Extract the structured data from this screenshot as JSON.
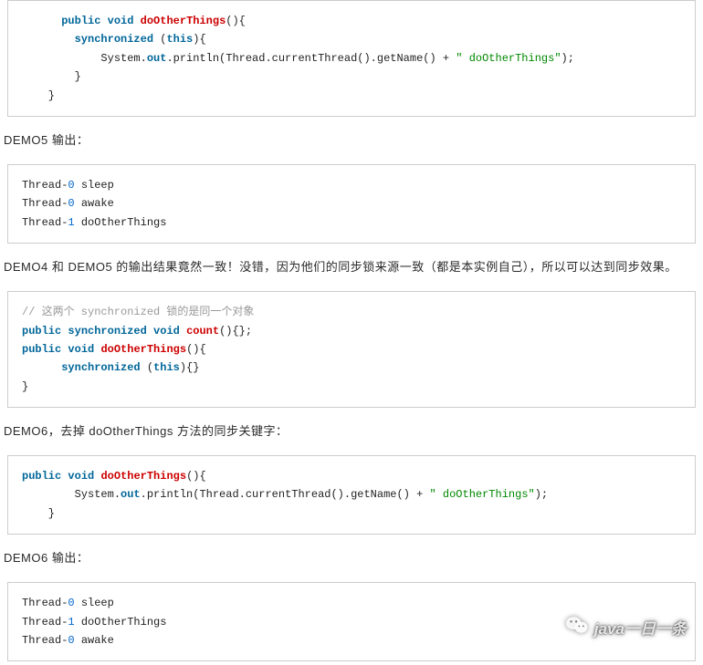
{
  "code1": {
    "l1_kw1": "public",
    "l1_kw2": "void",
    "l1_name": "doOtherThings",
    "l1_tail": "(){",
    "l2_kw": "synchronized",
    "l2_rest": " (",
    "l2_this": "this",
    "l2_tail": "){",
    "l3_a": "            System.",
    "l3_out": "out",
    "l3_b": ".println(Thread.currentThread().getName() + ",
    "l3_str": "\" doOtherThings\"",
    "l3_c": ");",
    "l4": "        }",
    "l5": "    }"
  },
  "para1": "DEMO5 输出：",
  "code2": {
    "r1a": "Thread-",
    "r1n": "0",
    "r1b": " sleep",
    "r2a": "Thread-",
    "r2n": "0",
    "r2b": " awake",
    "r3a": "Thread-",
    "r3n": "1",
    "r3b": " doOtherThings"
  },
  "para2": "DEMO4 和 DEMO5 的输出结果竟然一致！没错，因为他们的同步锁来源一致（都是本实例自己），所以可以达到同步效果。",
  "code3": {
    "cmt": "// 这两个 synchronized 锁的是同一个对象",
    "l1_kw1": "public",
    "l1_kw2": "synchronized",
    "l1_kw3": "void",
    "l1_name": "count",
    "l1_tail": "(){};",
    "l2_kw1": "public",
    "l2_kw2": "void",
    "l2_name": "doOtherThings",
    "l2_tail": "(){",
    "l3_kw": "synchronized",
    "l3_rest": " (",
    "l3_this": "this",
    "l3_tail": "){}",
    "l4": "}"
  },
  "para3": "DEMO6，去掉 doOtherThings 方法的同步关键字：",
  "code4": {
    "l1_kw1": "public",
    "l1_kw2": "void",
    "l1_name": "doOtherThings",
    "l1_tail": "(){",
    "l2_a": "        System.",
    "l2_out": "out",
    "l2_b": ".println(Thread.currentThread().getName() + ",
    "l2_str": "\" doOtherThings\"",
    "l2_c": ");",
    "l3": "    }"
  },
  "para4": "DEMO6 输出：",
  "code5": {
    "r1a": "Thread-",
    "r1n": "0",
    "r1b": " sleep",
    "r2a": "Thread-",
    "r2n": "1",
    "r2b": " doOtherThings",
    "r3a": "Thread-",
    "r3n": "0",
    "r3b": " awake"
  },
  "watermark": "java一日一条"
}
